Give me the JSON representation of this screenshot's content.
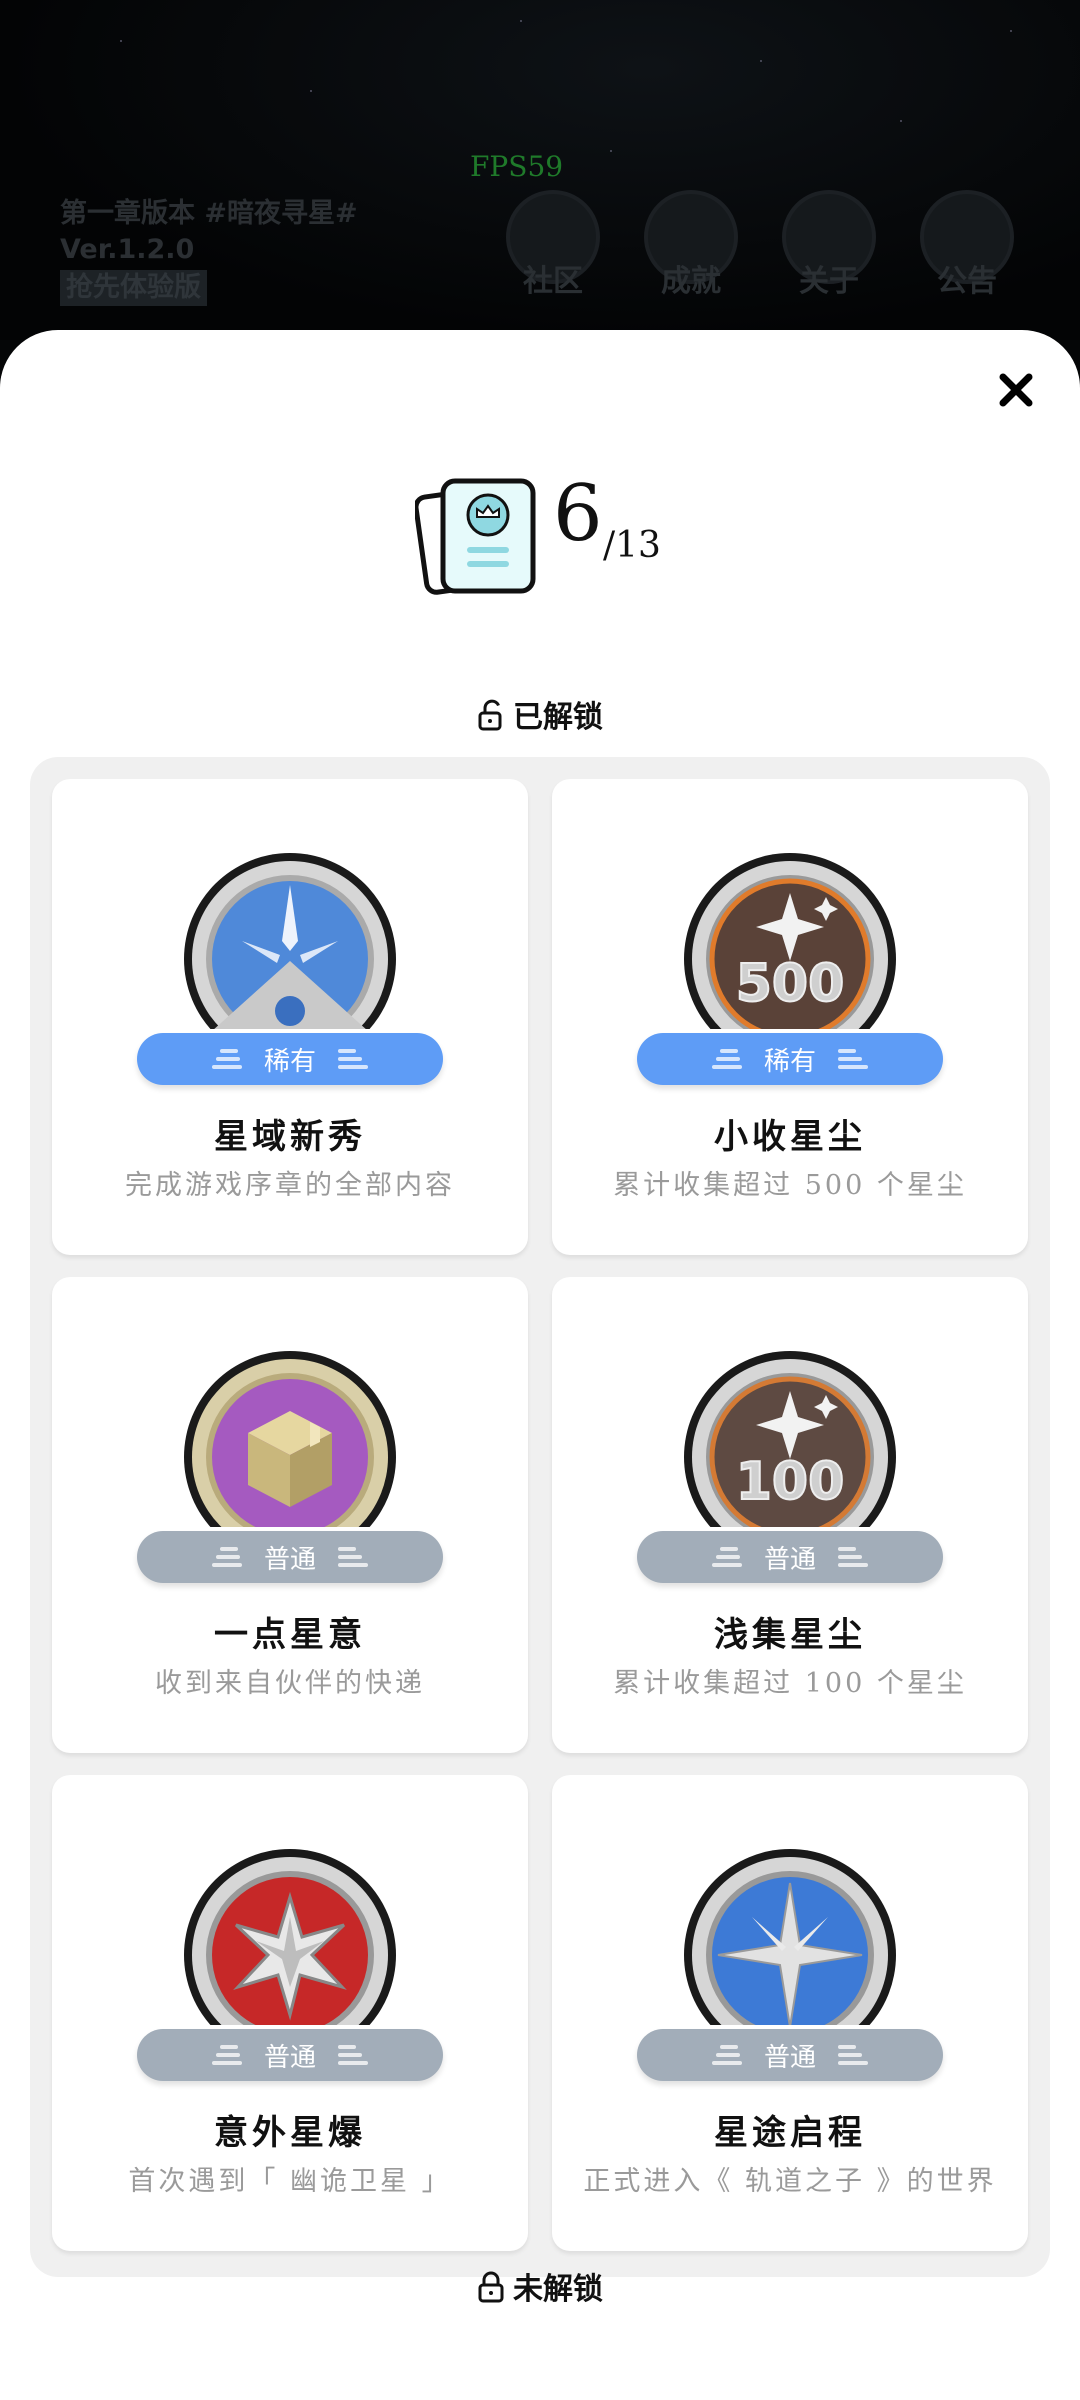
{
  "fps": "FPS59",
  "version": {
    "line1": "第一章版本 #暗夜寻星#",
    "line2": "Ver.1.2.0",
    "tag": "抢先体验版"
  },
  "top_nav": [
    {
      "label": "社区",
      "icon": "community-icon"
    },
    {
      "label": "成就",
      "icon": "achievement-icon"
    },
    {
      "label": "关于",
      "icon": "about-icon"
    },
    {
      "label": "公告",
      "icon": "announcement-icon"
    }
  ],
  "progress": {
    "unlocked": "6",
    "total": "/13"
  },
  "sections": {
    "unlocked": "已解锁",
    "locked": "未解锁"
  },
  "achievements": [
    {
      "title": "星域新秀",
      "desc": "完成游戏序章的全部内容",
      "rarity": "稀有",
      "rarity_type": "rare",
      "icon": "compass-star-icon"
    },
    {
      "title": "小收星尘",
      "desc": "累计收集超过 500 个星尘",
      "rarity": "稀有",
      "rarity_type": "rare",
      "icon": "stardust-500-icon"
    },
    {
      "title": "一点星意",
      "desc": "收到来自伙伴的快递",
      "rarity": "普通",
      "rarity_type": "normal",
      "icon": "package-icon"
    },
    {
      "title": "浅集星尘",
      "desc": "累计收集超过 100 个星尘",
      "rarity": "普通",
      "rarity_type": "normal",
      "icon": "stardust-100-icon"
    },
    {
      "title": "意外星爆",
      "desc": "首次遇到「 幽诡卫星 」",
      "rarity": "普通",
      "rarity_type": "normal",
      "icon": "starburst-icon"
    },
    {
      "title": "星途启程",
      "desc": "正式进入《 轨道之子 》的世界",
      "rarity": "普通",
      "rarity_type": "normal",
      "icon": "north-star-icon"
    }
  ],
  "colors": {
    "rare": "#5e9cf6",
    "normal": "#a2adb9"
  }
}
